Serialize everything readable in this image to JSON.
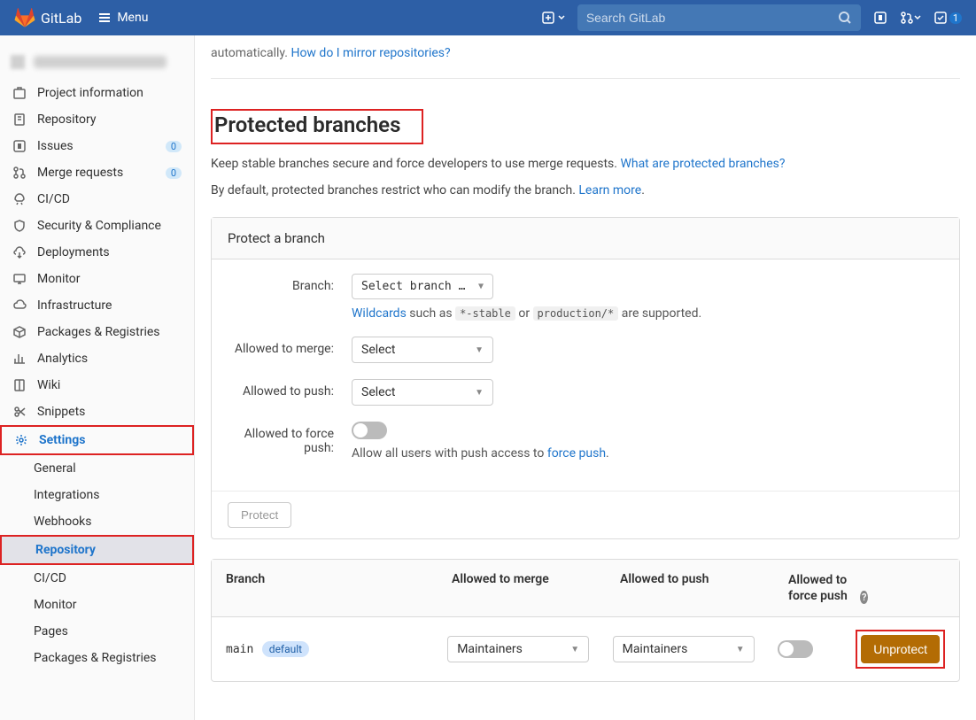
{
  "brand": "GitLab",
  "topbar": {
    "menu_label": "Menu",
    "search_placeholder": "Search GitLab",
    "todo_count": "1"
  },
  "sidebar": {
    "items": [
      {
        "label": "Project information"
      },
      {
        "label": "Repository"
      },
      {
        "label": "Issues",
        "badge": "0"
      },
      {
        "label": "Merge requests",
        "badge": "0"
      },
      {
        "label": "CI/CD"
      },
      {
        "label": "Security & Compliance"
      },
      {
        "label": "Deployments"
      },
      {
        "label": "Monitor"
      },
      {
        "label": "Infrastructure"
      },
      {
        "label": "Packages & Registries"
      },
      {
        "label": "Analytics"
      },
      {
        "label": "Wiki"
      },
      {
        "label": "Snippets"
      },
      {
        "label": "Settings"
      }
    ],
    "settings_sub": [
      {
        "label": "General"
      },
      {
        "label": "Integrations"
      },
      {
        "label": "Webhooks"
      },
      {
        "label": "Repository"
      },
      {
        "label": "CI/CD"
      },
      {
        "label": "Monitor"
      },
      {
        "label": "Pages"
      },
      {
        "label": "Packages & Registries"
      }
    ]
  },
  "main": {
    "trail_text_pre": "automatically. ",
    "trail_link": "How do I mirror repositories?",
    "title": "Protected branches",
    "desc1_pre": "Keep stable branches secure and force developers to use merge requests. ",
    "desc1_link": "What are protected branches?",
    "desc2_pre": "By default, protected branches restrict who can modify the branch. ",
    "desc2_link": "Learn more",
    "card_header": "Protect a branch",
    "form": {
      "branch_label": "Branch:",
      "branch_select": "Select branch …",
      "wildcards_link": "Wildcards",
      "wildcards_mid": " such as ",
      "code1": "*-stable",
      "wildcards_or": " or ",
      "code2": "production/*",
      "wildcards_end": " are supported.",
      "merge_label": "Allowed to merge:",
      "merge_select": "Select",
      "push_label": "Allowed to push:",
      "push_select": "Select",
      "force_label": "Allowed to force push:",
      "force_hint_pre": "Allow all users with push access to ",
      "force_hint_link": "force push",
      "protect_btn": "Protect"
    },
    "table": {
      "th_branch": "Branch",
      "th_merge": "Allowed to merge",
      "th_push": "Allowed to push",
      "th_force": "Allowed to force push",
      "row": {
        "branch_name": "main",
        "tag": "default",
        "merge_val": "Maintainers",
        "push_val": "Maintainers",
        "unprotect": "Unprotect"
      }
    }
  }
}
